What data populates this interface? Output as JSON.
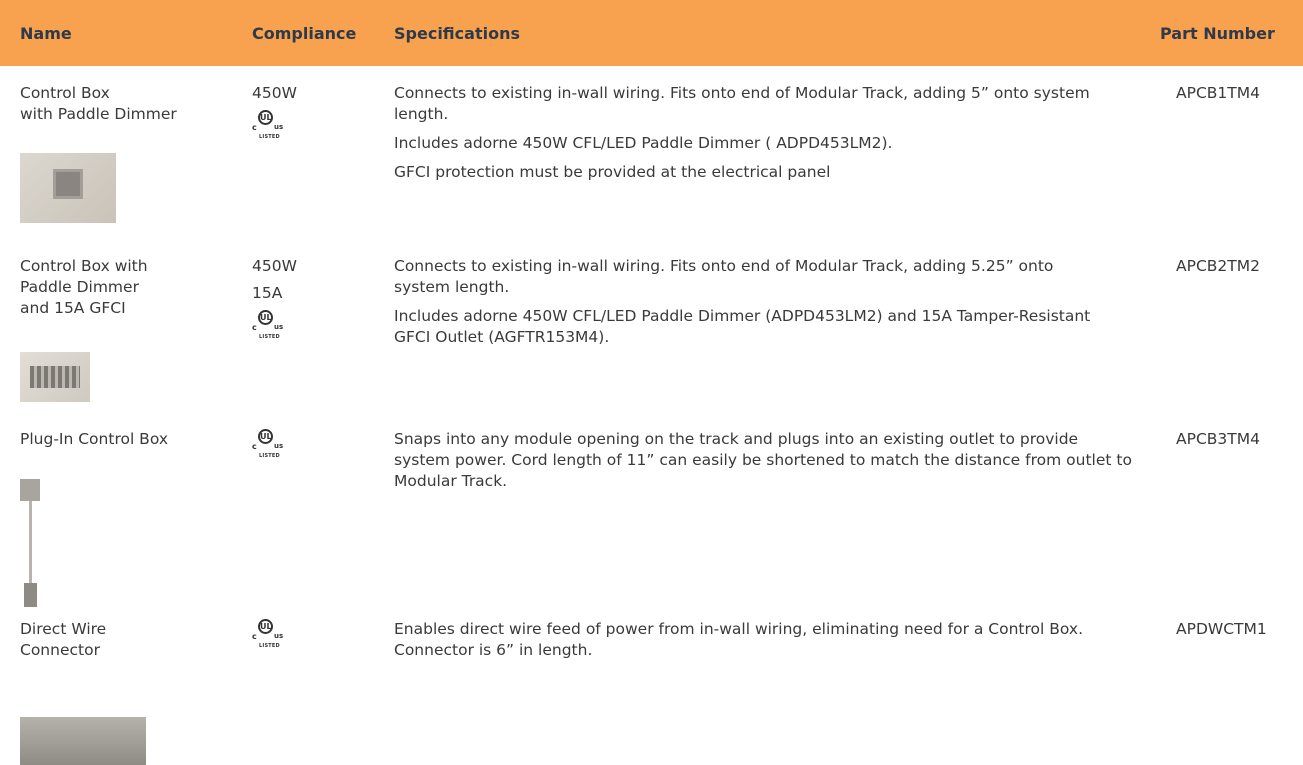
{
  "header": {
    "name": "Name",
    "compliance": "Compliance",
    "specifications": "Specifications",
    "part_number": "Part Number"
  },
  "ul_mark": {
    "c": "c",
    "ul": "UL",
    "us": "us",
    "listed": "LISTED"
  },
  "rows": [
    {
      "name_lines": [
        "Control Box",
        "with Paddle Dimmer"
      ],
      "compliance": [
        "450W"
      ],
      "specs": [
        "Connects to existing in-wall wiring. Fits onto end of Modular Track, adding 5” onto system length.",
        "Includes adorne 450W CFL/LED Paddle Dimmer ( ADPD453LM2).",
        "GFCI protection must be provided at the electrical panel"
      ],
      "part_number": "APCB1TM4"
    },
    {
      "name_lines": [
        "Control Box with",
        "Paddle Dimmer",
        "and 15A GFCI"
      ],
      "compliance": [
        "450W",
        "15A"
      ],
      "specs": [
        "Connects to existing in-wall wiring. Fits onto end of Modular Track, adding 5.25” onto system length.",
        "Includes adorne 450W CFL/LED Paddle Dimmer (ADPD453LM2) and 15A Tamper-Resistant GFCI Outlet (AGFTR153M4)."
      ],
      "part_number": "APCB2TM2"
    },
    {
      "name_lines": [
        "Plug-In Control Box"
      ],
      "compliance": [],
      "specs": [
        "Snaps into any module opening on the track and plugs into an existing outlet to provide system power. Cord length of 11” can easily be shortened to match the distance from outlet to Modular Track."
      ],
      "part_number": "APCB3TM4"
    },
    {
      "name_lines": [
        "Direct Wire",
        "Connector"
      ],
      "compliance": [],
      "specs": [
        "Enables direct wire feed of power from in-wall wiring, eliminating need for a Control Box. Connector is 6” in length."
      ],
      "part_number": "APDWCTM1"
    }
  ]
}
